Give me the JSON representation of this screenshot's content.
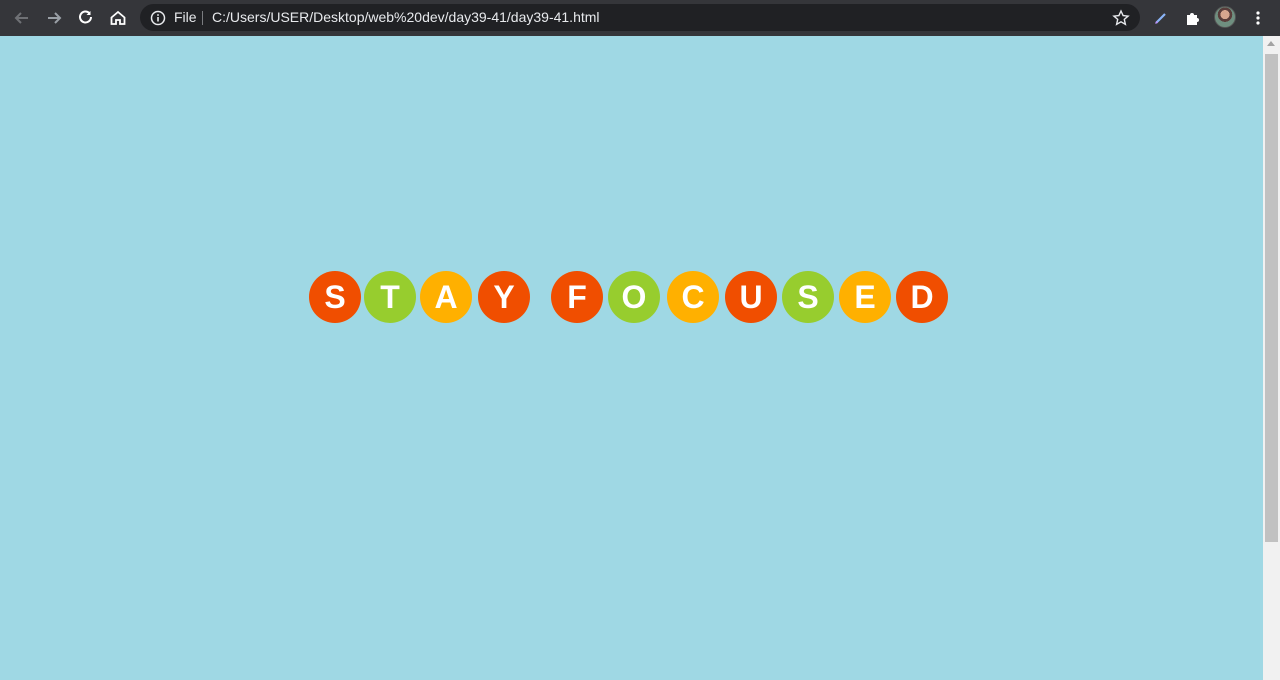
{
  "browser": {
    "omnibox": {
      "scheme_label": "File",
      "url": "C:/Users/USER/Desktop/web%20dev/day39-41/day39-41.html"
    },
    "icons": [
      "back-icon",
      "forward-icon",
      "reload-icon",
      "home-icon",
      "info-icon",
      "star-icon",
      "pen-icon",
      "extensions-icon",
      "more-icon"
    ]
  },
  "page": {
    "background": "#9fd8e4",
    "letters": [
      "S",
      "T",
      "A",
      "Y",
      "F",
      "O",
      "C",
      "U",
      "S",
      "E",
      "D"
    ],
    "colors": {
      "orange": "#f04e00",
      "green": "#97cd2e",
      "yellow": "#ffb000"
    }
  }
}
